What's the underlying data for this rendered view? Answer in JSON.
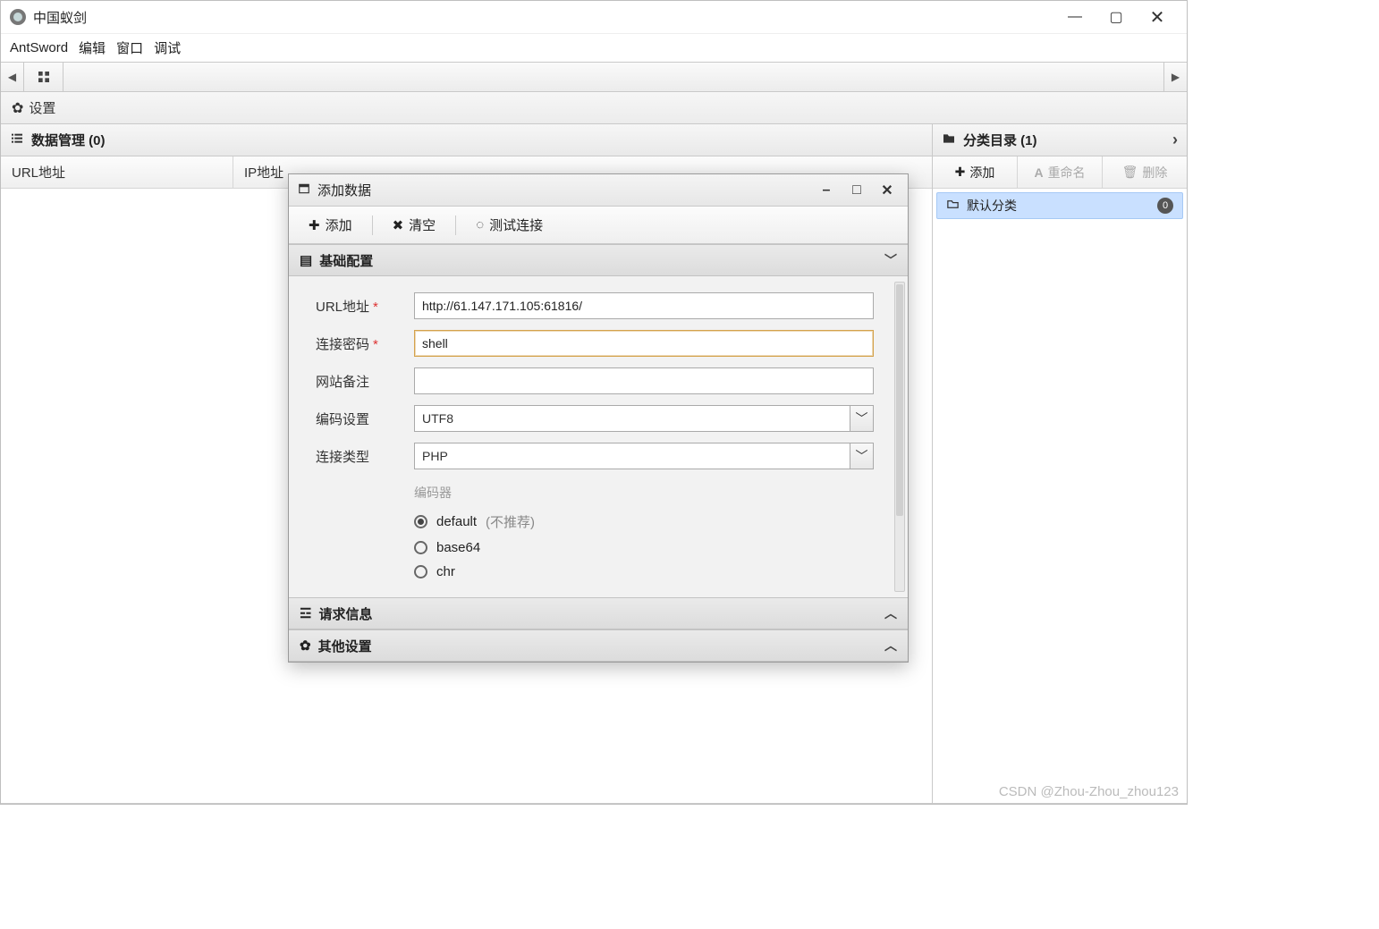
{
  "titlebar": {
    "title": "中国蚁剑"
  },
  "menubar": {
    "items": [
      "AntSword",
      "编辑",
      "窗口",
      "调试"
    ]
  },
  "settings": {
    "label": "设置"
  },
  "leftPanel": {
    "title": "数据管理 (0)",
    "columns": [
      "URL地址",
      "IP地址"
    ]
  },
  "rightPanel": {
    "title": "分类目录 (1)",
    "toolbar": {
      "add": "添加",
      "rename": "重命名",
      "delete": "删除"
    },
    "category": {
      "name": "默认分类",
      "count": "0"
    }
  },
  "dialog": {
    "title": "添加数据",
    "toolbar": {
      "add": "添加",
      "clear": "清空",
      "test": "测试连接"
    },
    "sections": {
      "basic": "基础配置",
      "request": "请求信息",
      "other": "其他设置"
    },
    "form": {
      "url": {
        "label": "URL地址",
        "value": "http://61.147.171.105:61816/"
      },
      "pwd": {
        "label": "连接密码",
        "value": "shell"
      },
      "note": {
        "label": "网站备注",
        "value": ""
      },
      "encode": {
        "label": "编码设置",
        "value": "UTF8"
      },
      "type": {
        "label": "连接类型",
        "value": "PHP"
      },
      "encoder": {
        "title": "编码器",
        "options": [
          {
            "label": "default",
            "hint": "(不推荐)",
            "checked": true
          },
          {
            "label": "base64",
            "hint": "",
            "checked": false
          },
          {
            "label": "chr",
            "hint": "",
            "checked": false
          }
        ]
      }
    }
  },
  "watermark": "CSDN @Zhou-Zhou_zhou123"
}
